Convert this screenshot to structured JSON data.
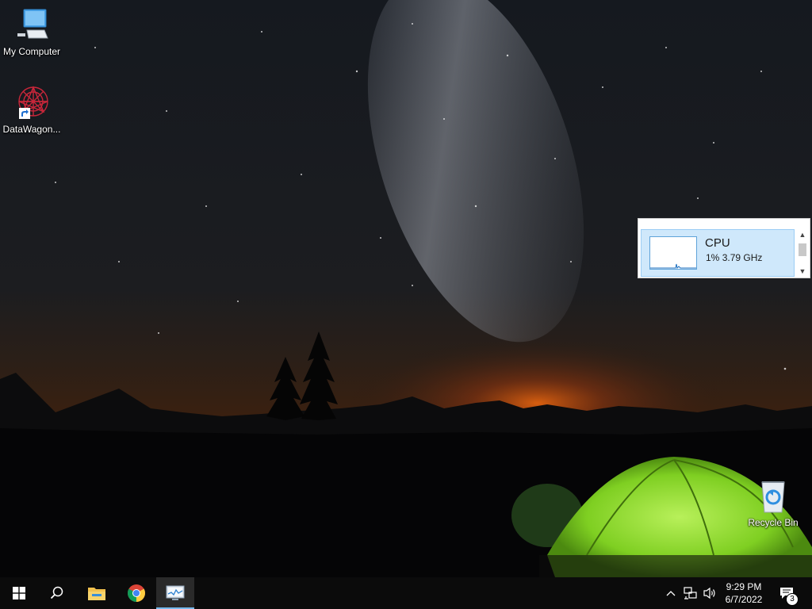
{
  "desktop": {
    "icons": [
      {
        "label": "My Computer",
        "icon": "computer-icon"
      },
      {
        "label": "DataWagon...",
        "icon": "datawagon-icon"
      },
      {
        "label": "Recycle Bin",
        "icon": "recycle-bin-icon"
      }
    ]
  },
  "cpu_widget": {
    "title": "CPU",
    "utilization": "1%",
    "speed": "3.79 GHz"
  },
  "taskbar": {
    "buttons": [
      {
        "name": "start",
        "icon": "windows-logo-icon"
      },
      {
        "name": "search",
        "icon": "search-icon"
      },
      {
        "name": "file-explorer",
        "icon": "folder-icon"
      },
      {
        "name": "chrome",
        "icon": "chrome-icon"
      },
      {
        "name": "task-manager",
        "icon": "task-manager-icon",
        "active": true
      }
    ],
    "tray": {
      "icons": [
        "chevron-up-icon",
        "network-icon",
        "volume-icon"
      ],
      "time": "9:29 PM",
      "date": "6/7/2022",
      "notification_count": "3"
    }
  },
  "colors": {
    "taskbar_bg": "#0b0b0b",
    "accent": "#76b9ed",
    "cpu_tile_bg": "#cfe8fb",
    "tent_green": "#8fdc2a"
  }
}
